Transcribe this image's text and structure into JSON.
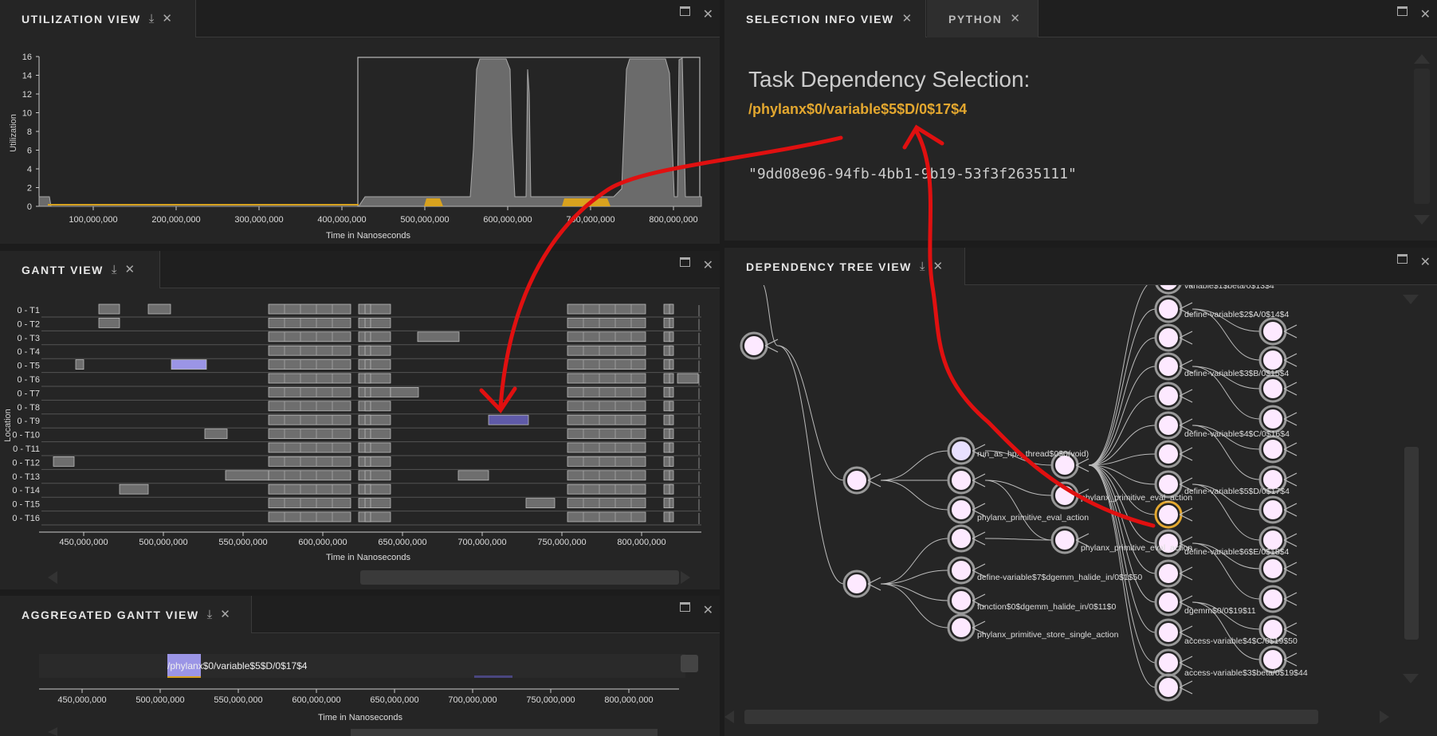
{
  "utilization": {
    "title": "UTILIZATION VIEW",
    "ylabel": "Utilization",
    "xlabel": "Time in Nanoseconds",
    "yticks": [
      "0",
      "2",
      "4",
      "6",
      "8",
      "10",
      "12",
      "14",
      "16"
    ],
    "xticks": [
      "100,000,000",
      "200,000,000",
      "300,000,000",
      "400,000,000",
      "500,000,000",
      "600,000,000",
      "700,000,000",
      "800,000,000"
    ]
  },
  "gantt": {
    "title": "GANTT VIEW",
    "ylabel": "Location",
    "xlabel": "Time in Nanoseconds",
    "rows": [
      "0 - T1",
      "0 - T2",
      "0 - T3",
      "0 - T4",
      "0 - T5",
      "0 - T6",
      "0 - T7",
      "0 - T8",
      "0 - T9",
      "0 - T10",
      "0 - T11",
      "0 - T12",
      "0 - T13",
      "0 - T14",
      "0 - T15",
      "0 - T16"
    ],
    "xticks": [
      "450,000,000",
      "500,000,000",
      "550,000,000",
      "600,000,000",
      "650,000,000",
      "700,000,000",
      "750,000,000",
      "800,000,000"
    ]
  },
  "aggregated": {
    "title": "AGGREGATED GANTT VIEW",
    "label": "/phylanx$0/variable$5$D/0$17$4",
    "xlabel": "Time in Nanoseconds",
    "xticks": [
      "450,000,000",
      "500,000,000",
      "550,000,000",
      "600,000,000",
      "650,000,000",
      "700,000,000",
      "750,000,000",
      "800,000,000"
    ]
  },
  "selection": {
    "tab_active": "SELECTION INFO VIEW",
    "tab_inactive": "PYTHON",
    "heading": "Task Dependency Selection:",
    "path": "/phylanx$0/variable$5$D/0$17$4",
    "id": "\"9dd08e96-94fb-4bb1-9b19-53f3f2635111\""
  },
  "tree": {
    "title": "DEPENDENCY TREE VIEW",
    "labels_mid": [
      "run_as_hpx_thread$0$0(void)",
      "phylanx_primitive_eval_action",
      "define-variable$7$dgemm_halide_in/0$1$50",
      "function$0$dgemm_halide_in/0$11$0",
      "phylanx_primitive_store_single_action"
    ],
    "labels_col3": [
      "phylanx_primitive_eval_action",
      "phylanx_primitive_eval_action"
    ],
    "labels_right": [
      "variable$1$beta/0$13$4",
      "define-variable$2$A/0$14$4",
      "define-variable$3$B/0$15$4",
      "define-variable$4$C/0$16$4",
      "define-variable$5$D/0$17$4",
      "define-variable$6$E/0$18$4",
      "dgemm$0/0$19$11",
      "access-variable$4$C/0$19$50",
      "access-variable$3$beta/0$19$44"
    ]
  },
  "colors": {
    "accent": "#e3a72f",
    "selected_bar": "#9b95e6",
    "node_fill": "#fde9ff",
    "annotation": "#e01010"
  }
}
